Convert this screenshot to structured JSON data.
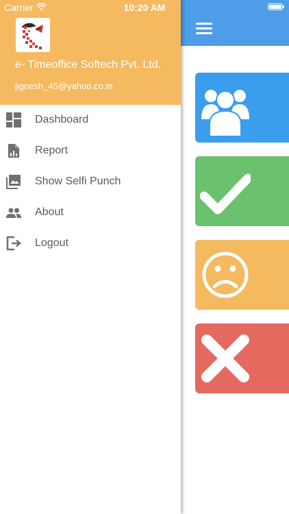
{
  "status_bar": {
    "carrier": "Carrier",
    "time": "10:20 AM"
  },
  "drawer": {
    "company_name": "e- Timeoffice Softech Pvt. Ltd.",
    "email": "jignesh_45@yahoo.co.in",
    "items": [
      {
        "label": "Dashboard",
        "icon": "dashboard-icon"
      },
      {
        "label": "Report",
        "icon": "report-icon"
      },
      {
        "label": "Show Selfi Punch",
        "icon": "photo-library-icon"
      },
      {
        "label": "About",
        "icon": "people-icon"
      },
      {
        "label": "Logout",
        "icon": "logout-icon"
      }
    ]
  },
  "main": {
    "tiles": [
      {
        "icon": "group-icon",
        "color": "#3a9ded"
      },
      {
        "icon": "checkmark-icon",
        "color": "#6bc16d"
      },
      {
        "icon": "sad-face-icon",
        "color": "#f5b95f"
      },
      {
        "icon": "cross-icon",
        "color": "#e46a60"
      }
    ]
  },
  "colors": {
    "header": "#f5b95f",
    "appbar": "#4d9de9",
    "menu_text": "#5b5b5b",
    "menu_icon": "#6f6f6f"
  }
}
